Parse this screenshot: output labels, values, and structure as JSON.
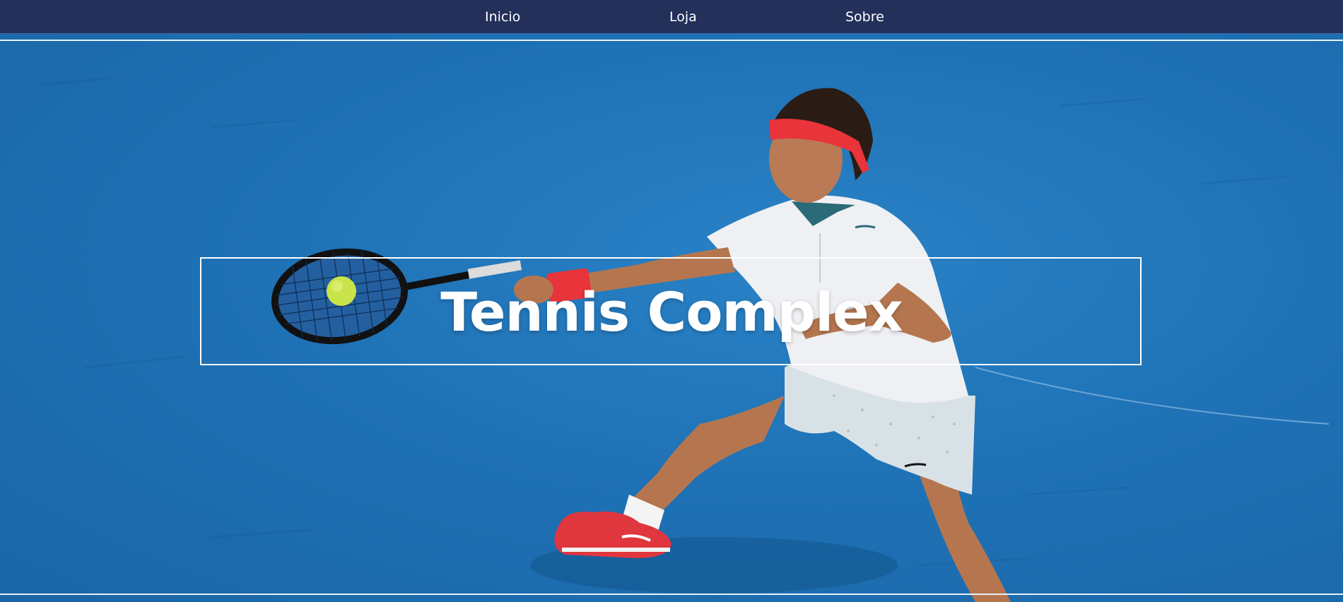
{
  "nav": {
    "items": [
      {
        "label": "Inicio"
      },
      {
        "label": "Loja"
      },
      {
        "label": "Sobre"
      }
    ]
  },
  "hero": {
    "title": "Tennis Complex",
    "image_subject": "tennis player hitting a forehand on a blue hard court"
  },
  "colors": {
    "navbar": "#22305a",
    "court": "#1e6fb3",
    "text": "#ffffff",
    "headband": "#e8343a"
  }
}
